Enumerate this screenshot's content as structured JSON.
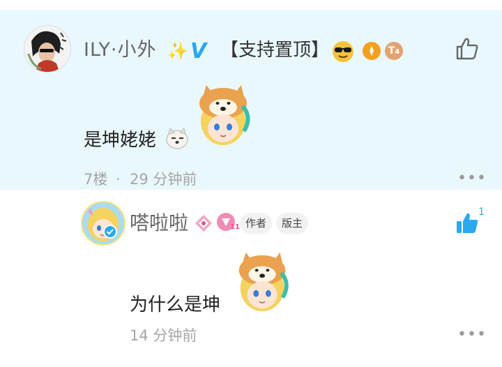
{
  "comment1": {
    "author_name": "ILY·小外",
    "sparkle": "✨",
    "verified": "V",
    "support_tag": "【支持置顶】",
    "level_badge": "T",
    "level_number": "4",
    "text": "是坤姥姥",
    "floor": "7楼",
    "separator": "·",
    "time": "29 分钟前",
    "more": "•••"
  },
  "comment2": {
    "author_name": "嗒啦啦",
    "level_number": "11",
    "author_tag": "作者",
    "mod_tag": "版主",
    "text": "为什么是坤",
    "time": "14 分钟前",
    "like_count": "1",
    "more": "•••"
  },
  "colors": {
    "highlight_bg": "#e9f8fc",
    "accent_blue": "#2ba8ee",
    "meta_gray": "#a5a5a5"
  }
}
